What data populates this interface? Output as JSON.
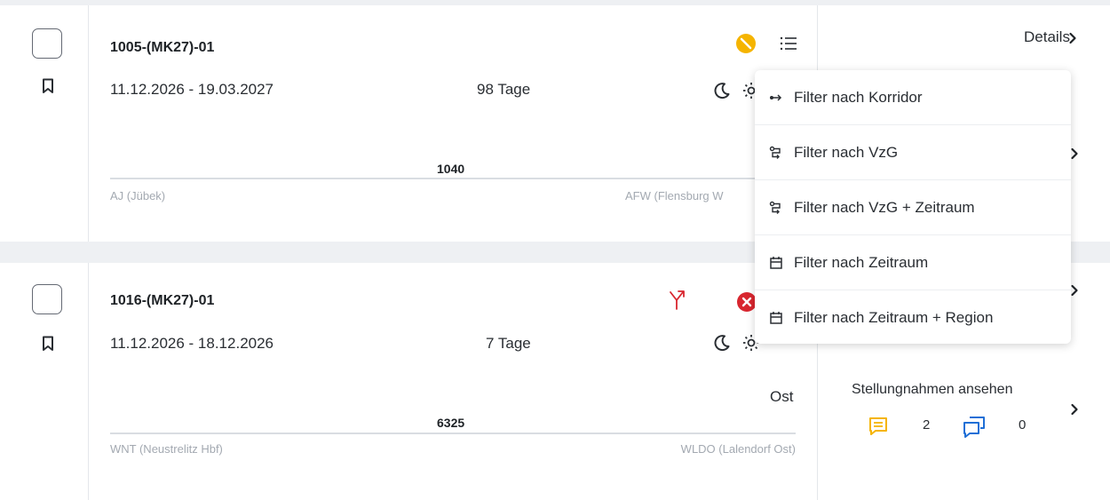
{
  "cards": [
    {
      "id": "1005-(MK27)-01",
      "dates": "11.12.2026 - 19.03.2027",
      "days": "98 Tage",
      "route_number": "1040",
      "from_station": "AJ (Jübek)",
      "to_station": "AFW (Flensburg W",
      "details_label": "Details"
    },
    {
      "id": "1016-(MK27)-01",
      "dates": "11.12.2026 - 18.12.2026",
      "days": "7 Tage",
      "region": "Ost",
      "route_number": "6325",
      "from_station": "WNT (Neustrelitz Hbf)",
      "to_station": "WLDO (Lalendorf Ost)",
      "statements_label": "Stellungnahmen ansehen",
      "statement_count_yellow": "2",
      "statement_count_blue": "0"
    }
  ],
  "filter_menu": {
    "items": [
      {
        "label": "Filter nach Korridor",
        "icon": "corridor-arrows-icon"
      },
      {
        "label": "Filter nach VzG",
        "icon": "route-branch-icon"
      },
      {
        "label": "Filter nach VzG + Zeitraum",
        "icon": "route-branch-icon"
      },
      {
        "label": "Filter nach Zeitraum",
        "icon": "calendar-icon"
      },
      {
        "label": "Filter nach Zeitraum + Region",
        "icon": "calendar-icon"
      }
    ]
  },
  "colors": {
    "warning_yellow": "#f5b400",
    "error_red": "#d8262f",
    "statement_yellow": "#f5b400",
    "statement_blue": "#1f6fd6",
    "divider": "#e4e7eb"
  }
}
